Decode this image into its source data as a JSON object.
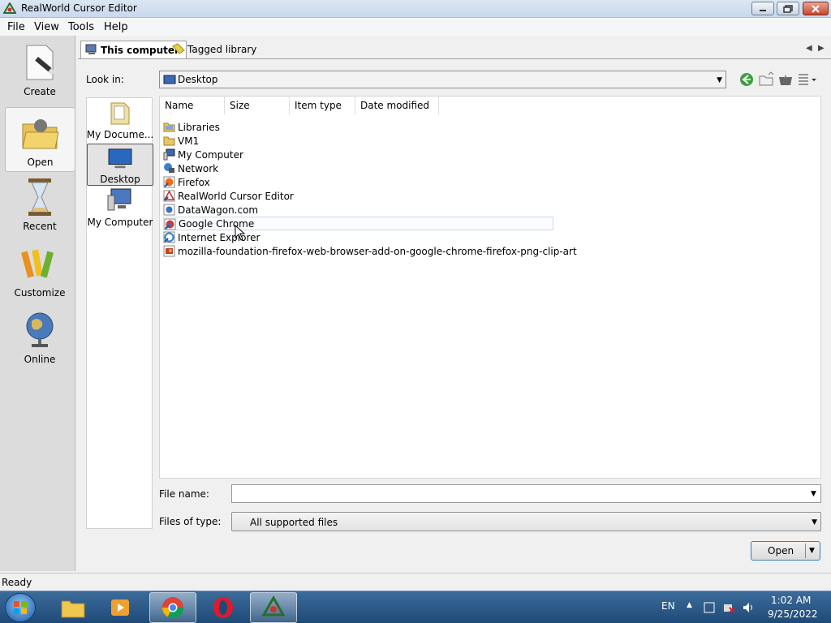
{
  "window": {
    "title": "RealWorld Cursor Editor"
  },
  "menu": [
    "File",
    "View",
    "Tools",
    "Help"
  ],
  "sidebar": [
    {
      "label": "Create",
      "icon": "create-icon"
    },
    {
      "label": "Open",
      "icon": "open-icon",
      "active": true
    },
    {
      "label": "Recent",
      "icon": "hourglass-icon"
    },
    {
      "label": "Customize",
      "icon": "crayons-icon"
    },
    {
      "label": "Online",
      "icon": "globe-icon"
    }
  ],
  "tabs": [
    {
      "label": "This computer",
      "active": true
    },
    {
      "label": "Tagged library"
    }
  ],
  "look_in": {
    "label": "Look in:",
    "value": "Desktop"
  },
  "places": [
    {
      "label": "My Docume..."
    },
    {
      "label": "Desktop",
      "active": true
    },
    {
      "label": "My Computer"
    }
  ],
  "columns": [
    "Name",
    "Size",
    "Item type",
    "Date modified"
  ],
  "files": [
    {
      "name": "Libraries",
      "icon": "library-folder-icon"
    },
    {
      "name": "VM1",
      "icon": "folder-icon"
    },
    {
      "name": "My Computer",
      "icon": "computer-icon"
    },
    {
      "name": "Network",
      "icon": "network-icon"
    },
    {
      "name": "Firefox",
      "icon": "shortcut-icon"
    },
    {
      "name": "RealWorld Cursor Editor",
      "icon": "shortcut-icon"
    },
    {
      "name": "DataWagon.com",
      "icon": "shortcut-icon"
    },
    {
      "name": "Google Chrome",
      "icon": "shortcut-icon",
      "hover": true
    },
    {
      "name": "Internet Explorer",
      "icon": "shortcut-icon"
    },
    {
      "name": "mozilla-foundation-firefox-web-browser-add-on-google-chrome-firefox-png-clip-art",
      "icon": "image-file-icon"
    }
  ],
  "file_name": {
    "label": "File name:",
    "value": ""
  },
  "file_type": {
    "label": "Files of type:",
    "value": "All supported files"
  },
  "open_button": "Open",
  "status": "Ready",
  "taskbar": {
    "lang": "EN",
    "time": "1:02 AM",
    "date": "9/25/2022"
  }
}
